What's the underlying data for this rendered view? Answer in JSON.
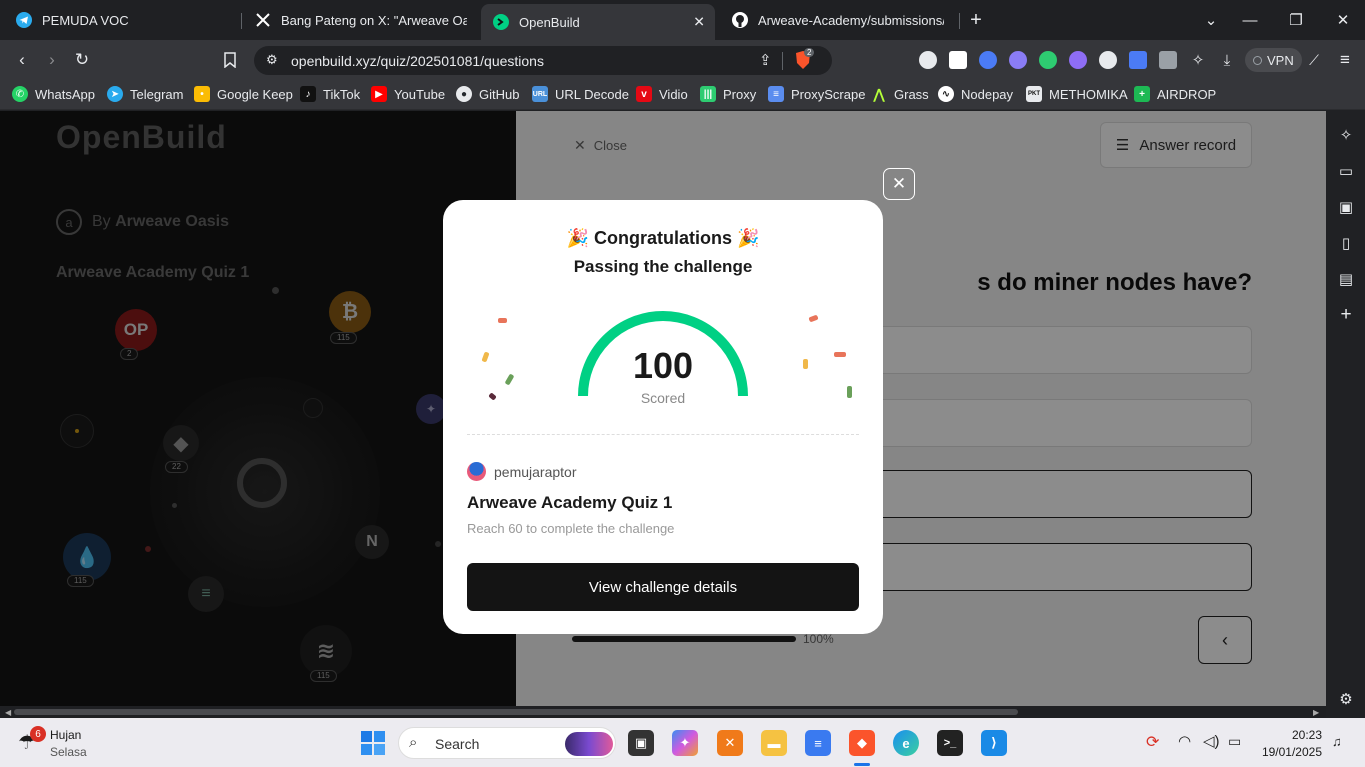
{
  "tabs": [
    {
      "title": "PEMUDA VOC",
      "icon": "telegram-icon"
    },
    {
      "title": "Bang Pateng on X: \"Arweave Oasis C",
      "icon": "x-icon"
    },
    {
      "title": "OpenBuild",
      "icon": "openbuild-icon",
      "active": true
    },
    {
      "title": "Arweave-Academy/submissions/rija",
      "icon": "github-icon"
    }
  ],
  "address_bar": {
    "url": "openbuild.xyz/quiz/202501081/questions",
    "vpn_label": "VPN",
    "brave_badge": "2"
  },
  "bookmarks": [
    {
      "label": "WhatsApp",
      "color": "#25d366"
    },
    {
      "label": "Telegram",
      "color": "#2aabee"
    },
    {
      "label": "Google Keep",
      "color": "#fbbc04"
    },
    {
      "label": "TikTok",
      "color": "#111111"
    },
    {
      "label": "YouTube",
      "color": "#ff0000"
    },
    {
      "label": "GitHub",
      "color": "#24292e"
    },
    {
      "label": "URL Decode",
      "color": "#4a90d9"
    },
    {
      "label": "Vidio",
      "color": "#e50914"
    },
    {
      "label": "Proxy",
      "color": "#2ecc71"
    },
    {
      "label": "ProxyScrape",
      "color": "#5b8def"
    },
    {
      "label": "Grass",
      "color": "#b4ff39"
    },
    {
      "label": "Nodepay",
      "color": "#ffffff"
    },
    {
      "label": "METHOMIKA",
      "color": "#333333"
    },
    {
      "label": "AIRDROP",
      "color": "#1db954"
    }
  ],
  "left_panel": {
    "logo": "OpenBuild",
    "by_prefix": "By",
    "by_org": "Arweave Oasis",
    "quiz_title": "Arweave Academy Quiz 1",
    "badges": {
      "op": "2",
      "btc": "115",
      "eth": "22",
      "sui": "115",
      "ar": "115"
    }
  },
  "right_panel": {
    "close_label": "Close",
    "answer_record_label": "Answer record",
    "question_fragment": "s do miner nodes have?",
    "progress_label": "100%"
  },
  "modal": {
    "title": "Congratulations",
    "subtitle": "Passing the challenge",
    "score": "100",
    "score_label": "Scored",
    "username": "pemujaraptor",
    "quiz_name": "Arweave Academy Quiz 1",
    "requirement": "Reach 60 to complete the challenge",
    "button": "View challenge details",
    "gauge_color": "#00d084"
  },
  "taskbar": {
    "weather_badge": "6",
    "weather_title": "Hujan",
    "weather_sub": "Selasa",
    "search_placeholder": "Search",
    "time": "20:23",
    "date": "19/01/2025"
  }
}
